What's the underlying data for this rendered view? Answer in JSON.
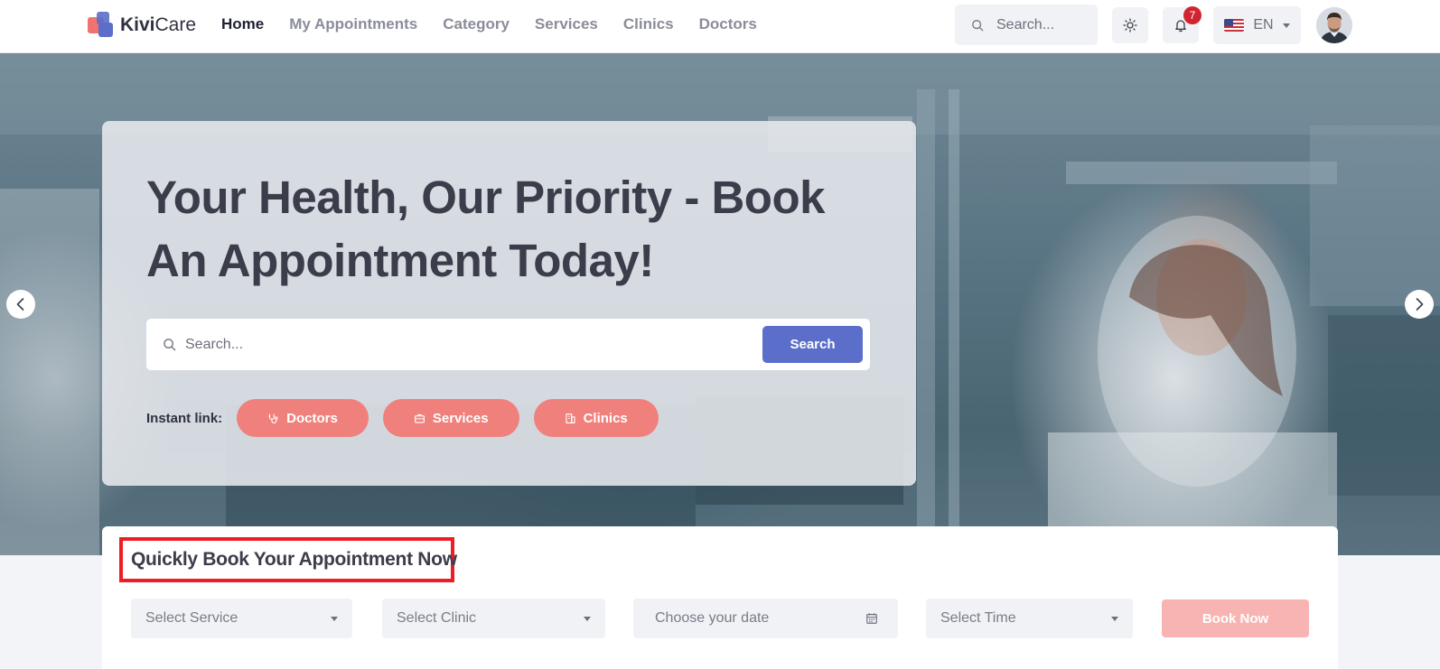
{
  "header": {
    "logo": {
      "text_bold": "Kivi",
      "text_regular": "Care"
    },
    "nav": [
      {
        "label": "Home",
        "active": true
      },
      {
        "label": "My Appointments",
        "active": false
      },
      {
        "label": "Category",
        "active": false
      },
      {
        "label": "Services",
        "active": false
      },
      {
        "label": "Clinics",
        "active": false
      },
      {
        "label": "Doctors",
        "active": false
      }
    ],
    "search_placeholder": "Search...",
    "theme_icon": "sun-icon",
    "notifications": {
      "icon": "bell-icon",
      "count": "7"
    },
    "language": {
      "flag": "us-flag-icon",
      "label": "EN"
    }
  },
  "hero": {
    "title": "Your Health, Our Priority - Book An Appointment Today!",
    "search_placeholder": "Search...",
    "search_button": "Search",
    "instant_label": "Instant link:",
    "instant_links": [
      {
        "label": "Doctors",
        "icon": "stethoscope-icon"
      },
      {
        "label": "Services",
        "icon": "briefcase-icon"
      },
      {
        "label": "Clinics",
        "icon": "building-icon"
      }
    ]
  },
  "booking": {
    "title": "Quickly Book Your Appointment Now",
    "service_placeholder": "Select Service",
    "clinic_placeholder": "Select Clinic",
    "date_placeholder": "Choose your date",
    "time_placeholder": "Select Time",
    "book_button": "Book Now"
  },
  "colors": {
    "primary": "#5b6ec9",
    "accent": "#f0807c",
    "book_disabled": "#f8b4b2",
    "highlight_border": "#ee1c25",
    "badge": "#d0252f"
  }
}
